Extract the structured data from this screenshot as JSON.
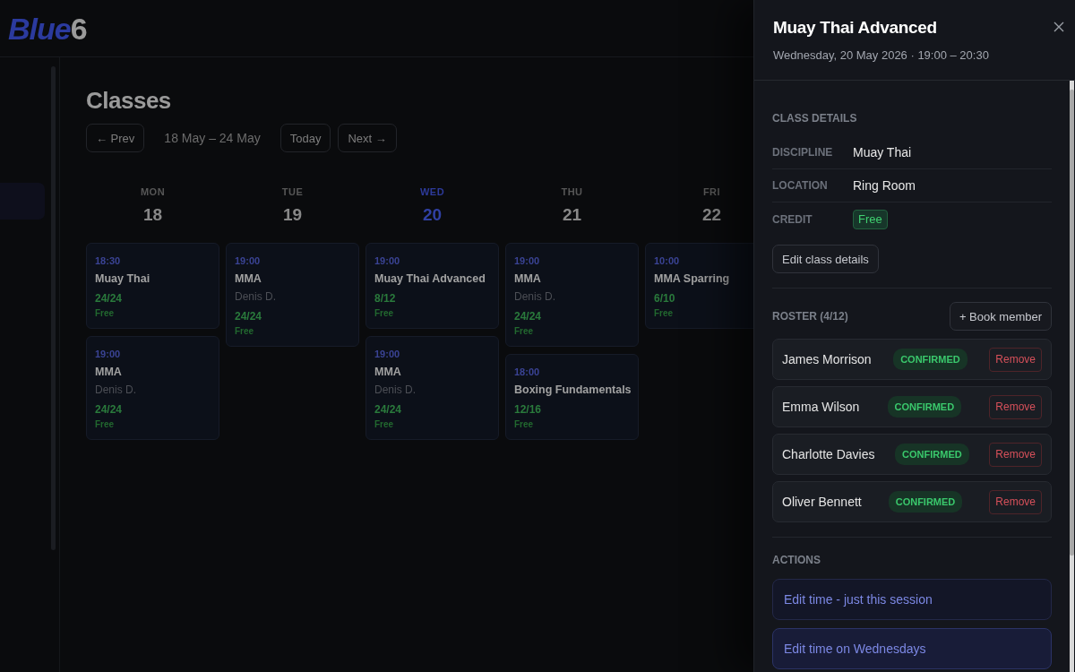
{
  "header": {
    "logo": {
      "primary": "Blue",
      "secondary": "6"
    }
  },
  "sidebar": {
    "items": [
      {
        "selected": true
      }
    ]
  },
  "page": {
    "title": "Classes",
    "nav": {
      "prev": "← Prev",
      "range": "18 May – 24 May",
      "today": "Today",
      "next": "Next →"
    }
  },
  "calendar": {
    "days": [
      {
        "weekday": "MON",
        "date": "18",
        "selected": false,
        "classes": [
          {
            "time": "18:30",
            "name": "Muay Thai",
            "capacity": "24/24",
            "credit": "Free"
          },
          {
            "time": "19:00",
            "name": "MMA",
            "instructor": "Denis D.",
            "capacity": "24/24",
            "credit": "Free"
          }
        ]
      },
      {
        "weekday": "TUE",
        "date": "19",
        "selected": false,
        "classes": [
          {
            "time": "19:00",
            "name": "MMA",
            "instructor": "Denis D.",
            "capacity": "24/24",
            "credit": "Free"
          }
        ]
      },
      {
        "weekday": "WED",
        "date": "20",
        "selected": true,
        "classes": [
          {
            "time": "19:00",
            "name": "Muay Thai Advanced",
            "capacity": "8/12",
            "credit": "Free"
          },
          {
            "time": "19:00",
            "name": "MMA",
            "instructor": "Denis D.",
            "capacity": "24/24",
            "credit": "Free"
          }
        ]
      },
      {
        "weekday": "THU",
        "date": "21",
        "selected": false,
        "classes": [
          {
            "time": "19:00",
            "name": "MMA",
            "instructor": "Denis D.",
            "capacity": "24/24",
            "credit": "Free"
          },
          {
            "time": "18:00",
            "name": "Boxing Fundamentals",
            "capacity": "12/16",
            "credit": "Free"
          }
        ]
      },
      {
        "weekday": "FRI",
        "date": "22",
        "selected": false,
        "classes": [
          {
            "time": "10:00",
            "name": "MMA Sparring",
            "capacity": "6/10",
            "credit": "Free"
          }
        ]
      }
    ]
  },
  "drawer": {
    "title": "Muay Thai Advanced",
    "subtitle": "Wednesday, 20 May 2026 · 19:00 – 20:30",
    "details": {
      "heading": "CLASS DETAILS",
      "rows": [
        {
          "kind": "text",
          "label": "DISCIPLINE",
          "value": "Muay Thai"
        },
        {
          "kind": "text",
          "label": "LOCATION",
          "value": "Ring Room"
        },
        {
          "kind": "badge",
          "label": "CREDIT",
          "value": "Free"
        }
      ],
      "edit_button": "Edit class details"
    },
    "roster": {
      "heading": "ROSTER (4/12)",
      "add_button": "+ Book member",
      "members": [
        {
          "name": "James Morrison",
          "status": "CONFIRMED",
          "remove": "Remove"
        },
        {
          "name": "Emma Wilson",
          "status": "CONFIRMED",
          "remove": "Remove"
        },
        {
          "name": "Charlotte Davies",
          "status": "CONFIRMED",
          "remove": "Remove"
        },
        {
          "name": "Oliver Bennett",
          "status": "CONFIRMED",
          "remove": "Remove"
        }
      ]
    },
    "actions": {
      "heading": "ACTIONS",
      "buttons": [
        {
          "label": "Edit time - just this session",
          "highlighted": false
        },
        {
          "label": "Edit time on Wednesdays",
          "highlighted": true
        }
      ]
    }
  }
}
